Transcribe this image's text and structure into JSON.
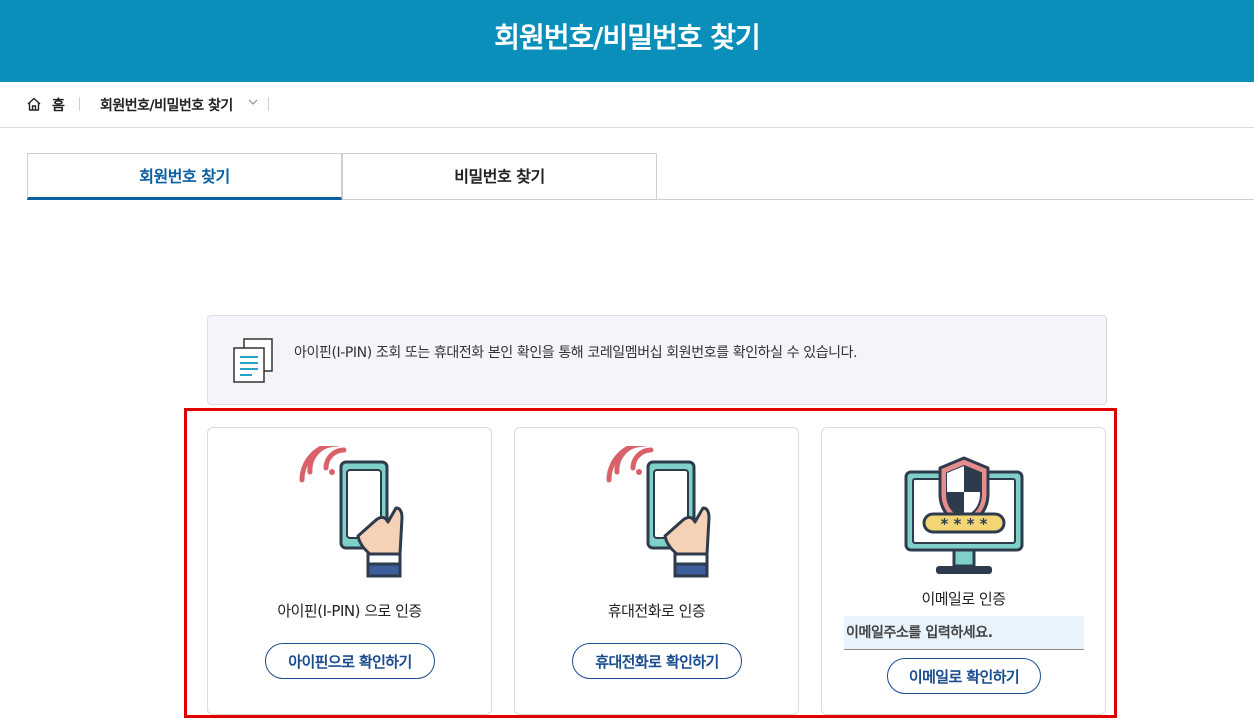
{
  "header": {
    "title": "회원번호/비밀번호 찾기"
  },
  "breadcrumb": {
    "home": "홈",
    "current": "회원번호/비밀번호 찾기"
  },
  "tabs": [
    {
      "label": "회원번호 찾기",
      "active": true
    },
    {
      "label": "비밀번호 찾기",
      "active": false
    }
  ],
  "info": {
    "text": "아이핀(I-PIN) 조회 또는 휴대전화 본인 확인을 통해 코레일멤버십 회원번호를 확인하실 수 있습니다."
  },
  "cards": [
    {
      "title": "아이핀(I-PIN) 으로 인증",
      "button": "아이핀으로 확인하기",
      "icon": "phone-hand-icon"
    },
    {
      "title": "휴대전화로 인증",
      "button": "휴대전화로 확인하기",
      "icon": "phone-hand-icon"
    },
    {
      "title": "이메일로 인증",
      "button": "이메일로 확인하기",
      "icon": "monitor-shield-icon",
      "input_placeholder": "이메일주소를 입력하세요."
    }
  ],
  "colors": {
    "header": "#0a8fba",
    "accent": "#0a5fa0",
    "button": "#1a4d8f",
    "highlight": "#e00000"
  }
}
